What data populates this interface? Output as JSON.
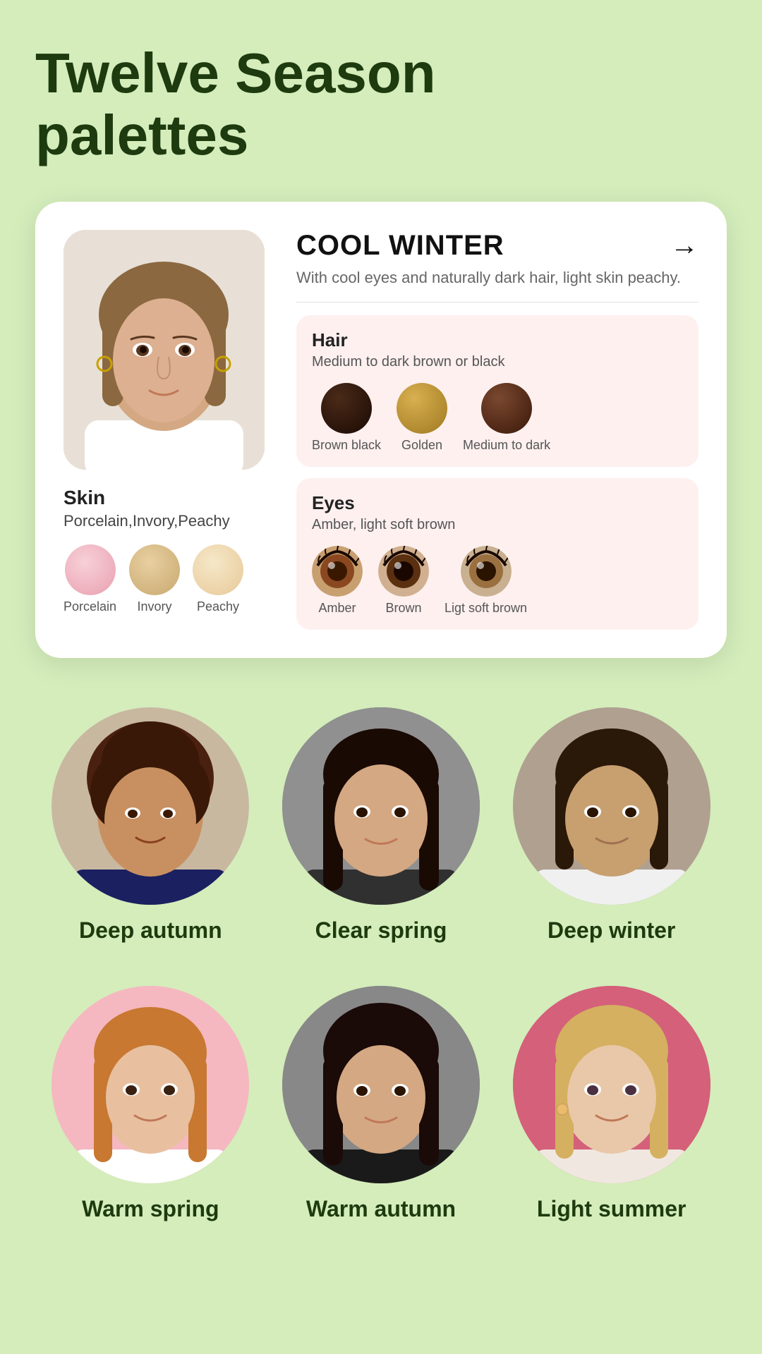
{
  "page": {
    "title_line1": "Twelve Season",
    "title_line2": "palettes"
  },
  "card": {
    "season_title": "COOL WINTER",
    "season_desc": "With cool eyes and naturally dark hair, light skin peachy.",
    "arrow": "→",
    "skin": {
      "label": "Skin",
      "sublabel": "Porcelain,Invory,Peachy",
      "swatches": [
        {
          "name": "Porcelain",
          "color": "#f0b8c0"
        },
        {
          "name": "Invory",
          "color": "#e8c89a"
        },
        {
          "name": "Peachy",
          "color": "#f5ddb8"
        }
      ]
    },
    "hair": {
      "title": "Hair",
      "subtitle": "Medium to dark brown or black",
      "swatches": [
        {
          "name": "Brown black",
          "color": "#2a1a0e"
        },
        {
          "name": "Golden",
          "color": "#c8a040"
        },
        {
          "name": "Medium to dark",
          "color": "#5a3020"
        }
      ]
    },
    "eyes": {
      "title": "Eyes",
      "subtitle": "Amber, light soft brown",
      "swatches": [
        {
          "name": "Amber",
          "color": "#8b4020"
        },
        {
          "name": "Brown",
          "color": "#5a3010"
        },
        {
          "name": "Ligt soft brown",
          "color": "#9a6830"
        }
      ]
    }
  },
  "portraits_row1": [
    {
      "label": "Deep autumn",
      "bg": "bg-light"
    },
    {
      "label": "Clear spring",
      "bg": "bg-dark"
    },
    {
      "label": "Deep winter",
      "bg": "bg-medium"
    }
  ],
  "portraits_row2": [
    {
      "label": "Warm spring",
      "bg": "bg-pink"
    },
    {
      "label": "Warm autumn",
      "bg": "bg-gray"
    },
    {
      "label": "Light summer",
      "bg": "bg-rose"
    }
  ]
}
